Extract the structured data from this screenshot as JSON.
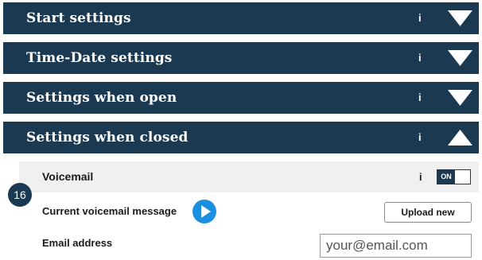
{
  "sections": [
    {
      "title": "Start settings",
      "info": "i",
      "state": "collapsed"
    },
    {
      "title": "Time-Date settings",
      "info": "i",
      "state": "collapsed"
    },
    {
      "title": "Settings when open",
      "info": "i",
      "state": "collapsed"
    },
    {
      "title": "Settings when closed",
      "info": "i",
      "state": "expanded"
    }
  ],
  "voicemail": {
    "title": "Voicemail",
    "info": "i",
    "toggle_label": "ON",
    "toggle_state": true
  },
  "step_badge": "16",
  "current_message": {
    "label": "Current voicemail message",
    "upload_label": "Upload new"
  },
  "email": {
    "label": "Email address",
    "placeholder": "your@email.com"
  },
  "colors": {
    "header_bg": "#1b3a52",
    "play_button": "#1a8fe0",
    "sub_row_bg": "#f0f0f0"
  }
}
